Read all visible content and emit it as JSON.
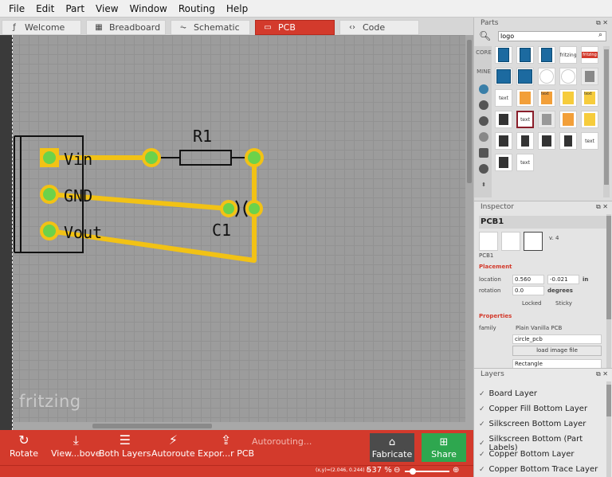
{
  "menu": [
    "File",
    "Edit",
    "Part",
    "View",
    "Window",
    "Routing",
    "Help"
  ],
  "tabs": [
    {
      "label": "Welcome",
      "icon": "fritzing-icon"
    },
    {
      "label": "Breadboard",
      "icon": "breadboard-icon"
    },
    {
      "label": "Schematic",
      "icon": "schematic-icon"
    },
    {
      "label": "PCB",
      "icon": "pcb-icon",
      "active": true
    },
    {
      "label": "Code",
      "icon": "code-icon"
    }
  ],
  "canvas": {
    "watermark": "fritzing",
    "pins": [
      "Vin",
      "GND",
      "Vout"
    ],
    "resistor_label": "R1",
    "capacitor_label": "C1",
    "trace_color": "#f2c215",
    "pad_color": "#6cd24a"
  },
  "toolbar": {
    "rotate": "Rotate",
    "view": "View...bove",
    "both_layers": "Both Layers",
    "autoroute": "Autoroute",
    "export": "Expor...r PCB",
    "status": "Autorouting...",
    "fabricate": "Fabricate",
    "share": "Share"
  },
  "statusbar": {
    "coords": "(x,y)=(2.046, 0.244) in",
    "zoom": "537 %"
  },
  "parts": {
    "title": "Parts",
    "search_value": "logo",
    "bins": [
      "CORE",
      "MINE"
    ],
    "cell_texts": [
      "fritzing",
      "fritzing",
      "text",
      "text",
      "text",
      "text",
      "text",
      "text",
      "text"
    ]
  },
  "inspector": {
    "title": "Inspector",
    "name": "PCB1",
    "version": "v. 4",
    "sub": "PCB1",
    "placement_label": "Placement",
    "location_label": "location",
    "location_x": "0.560",
    "location_y": "-0.021",
    "location_unit": "in",
    "rotation_label": "rotation",
    "rotation_value": "0.0",
    "rotation_unit": "degrees",
    "locked": "Locked",
    "sticky": "Sticky",
    "properties_label": "Properties",
    "family_label": "family",
    "family_value": "Plain Vanilla PCB",
    "shape_value": "circle_pcb",
    "load_image": "load image file",
    "layers_value": "Rectangle"
  },
  "layers": {
    "title": "Layers",
    "items": [
      "Board Layer",
      "Copper Fill Bottom Layer",
      "Silkscreen Bottom Layer",
      "Silkscreen Bottom (Part Labels)",
      "Copper Bottom Layer",
      "Copper Bottom Trace Layer"
    ]
  }
}
